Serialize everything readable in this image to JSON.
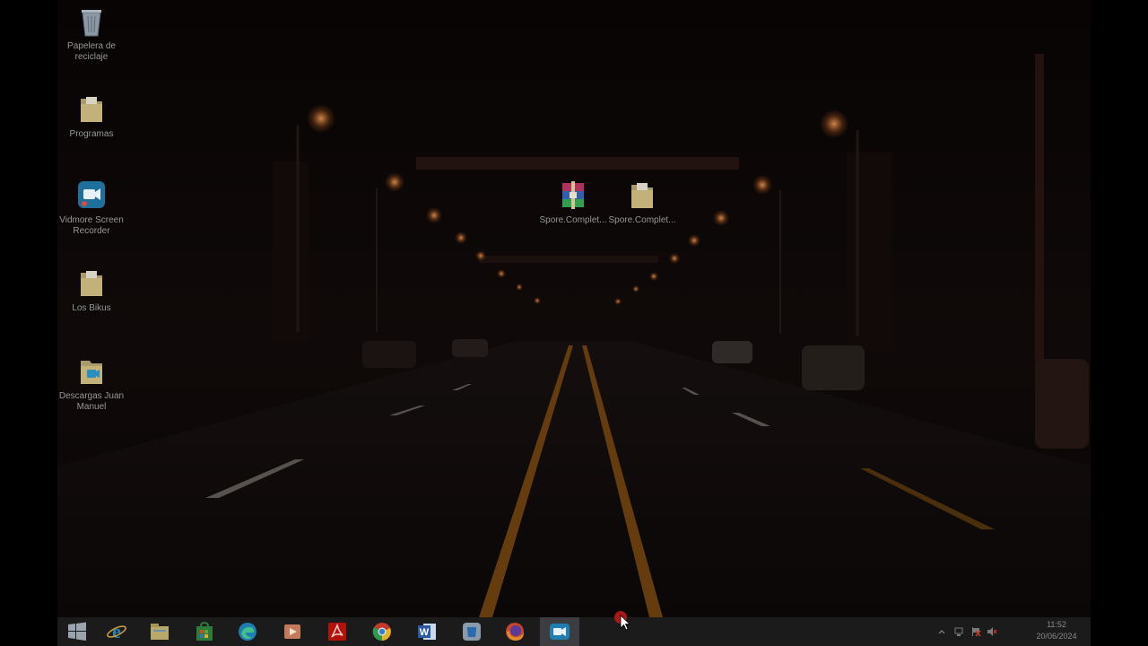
{
  "desktop": {
    "icons": [
      {
        "label": "Papelera de reciclaje",
        "icon": "recycle-bin-icon"
      },
      {
        "label": "Programas",
        "icon": "folder-icon"
      },
      {
        "label": "Vidmore Screen Recorder",
        "icon": "vidmore-recorder-icon"
      },
      {
        "label": "Los Bikus",
        "icon": "folder-icon"
      },
      {
        "label": "Descargas Juan Manuel",
        "icon": "folder-video-icon"
      },
      {
        "label": "Spore.Complet...",
        "icon": "winrar-archive-icon"
      },
      {
        "label": "Spore.Complet...",
        "icon": "folder-icon"
      }
    ]
  },
  "taskbar": {
    "apps": [
      {
        "name": "Start",
        "icon": "windows-start-icon"
      },
      {
        "name": "Internet Explorer",
        "icon": "internet-explorer-icon"
      },
      {
        "name": "File Explorer",
        "icon": "file-explorer-icon"
      },
      {
        "name": "Microsoft Store",
        "icon": "store-icon"
      },
      {
        "name": "Microsoft Edge",
        "icon": "edge-icon"
      },
      {
        "name": "Media Player",
        "icon": "media-player-icon"
      },
      {
        "name": "Adobe Acrobat",
        "icon": "acrobat-icon"
      },
      {
        "name": "Google Chrome",
        "icon": "chrome-icon"
      },
      {
        "name": "Microsoft Word",
        "icon": "word-icon"
      },
      {
        "name": "App",
        "icon": "app-icon"
      },
      {
        "name": "Firefox",
        "icon": "firefox-icon"
      },
      {
        "name": "Vidmore Screen Recorder",
        "icon": "vidmore-recorder-icon",
        "active": true
      }
    ],
    "tray": {
      "icons": [
        "chevron-up-icon",
        "network-icon",
        "flag-icon",
        "volume-icon"
      ],
      "time": "11:52",
      "date": "20/06/2024"
    }
  },
  "colors": {
    "taskbar_bg": "#1b1b1c",
    "active_app_bg": "#3b3d40",
    "icon_label": "#9a9a9a",
    "wallpaper_light": "#ffb060"
  }
}
